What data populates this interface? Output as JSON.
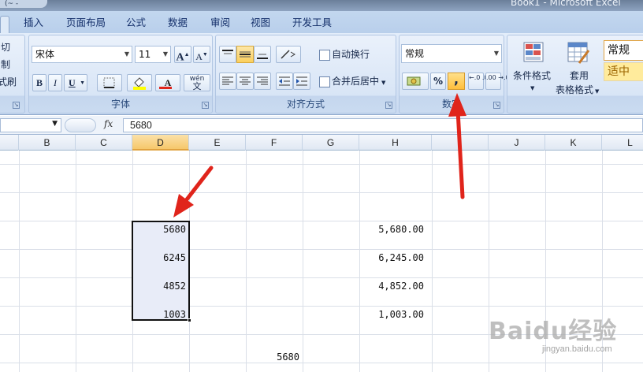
{
  "window": {
    "title": "Book1 - Microsoft Excel",
    "qat": "(~ -"
  },
  "tabs": [
    {
      "label": "插入"
    },
    {
      "label": "页面布局"
    },
    {
      "label": "公式"
    },
    {
      "label": "数据"
    },
    {
      "label": "审阅"
    },
    {
      "label": "视图"
    },
    {
      "label": "开发工具"
    }
  ],
  "clipboard": {
    "cut": "切",
    "copy": "制",
    "format_painter": "式刷"
  },
  "font_group": {
    "label": "字体",
    "font_name": "宋体",
    "font_size": "11",
    "grow": "A",
    "shrink": "A",
    "bold": "B",
    "italic": "I",
    "underline": "U",
    "font_color": "A",
    "phonetic": "wén"
  },
  "alignment_group": {
    "label": "对齐方式",
    "wrap_text": "自动换行",
    "merge_center": "合并后居中"
  },
  "number_group": {
    "label": "数字",
    "format": "常规",
    "percent": "%",
    "comma": ",",
    "inc_decimal": "←.0 .00",
    "dec_decimal": ".00 →.0"
  },
  "styles_group": {
    "conditional_format": "条件格式",
    "format_as_table_1": "套用",
    "format_as_table_2": "表格格式",
    "style_normal": "常规",
    "style_neutral": "适中"
  },
  "formula_bar": {
    "fx": "fx",
    "value": "5680"
  },
  "columns": [
    "B",
    "C",
    "D",
    "E",
    "F",
    "G",
    "H",
    "I",
    "J",
    "K",
    "L"
  ],
  "selected_column": "D",
  "cells": {
    "D_values": [
      "5680",
      "6245",
      "4852",
      "1003"
    ],
    "H_values": [
      "5,680.00",
      "6,245.00",
      "4,852.00",
      "1,003.00"
    ],
    "F_bottom": "5680"
  },
  "watermark": {
    "brand": "Baidu经验",
    "url": "jingyan.baidu.com"
  },
  "colors": {
    "annotation_arrow": "#e0241b",
    "selection_fill": "#e8ecf8",
    "highlight_button": "#fbcf5c"
  }
}
